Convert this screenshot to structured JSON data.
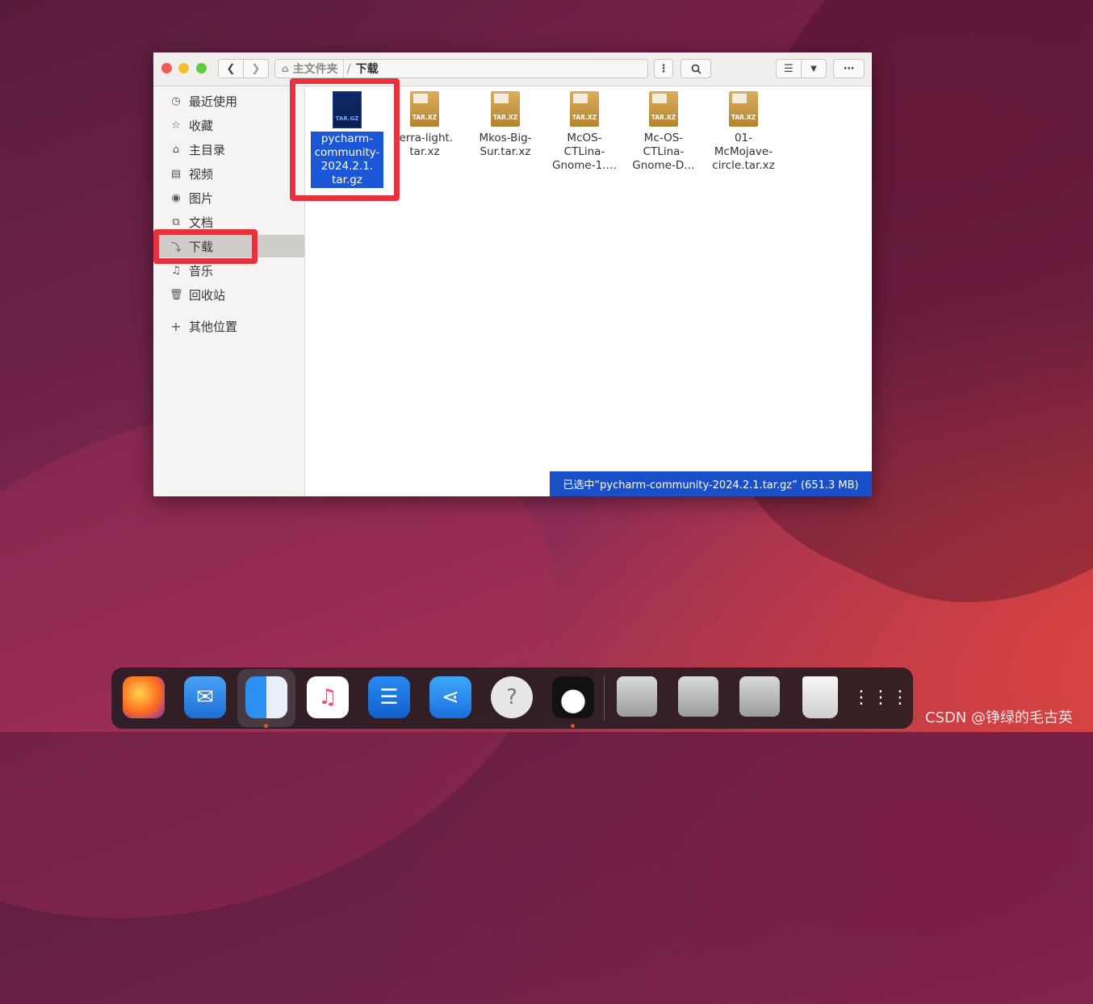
{
  "window": {
    "breadcrumb": {
      "home": "主文件夹",
      "separator": "/",
      "current": "下载"
    }
  },
  "sidebar": {
    "items": [
      {
        "label": "最近使用",
        "icon": "clock-icon"
      },
      {
        "label": "收藏",
        "icon": "star-icon"
      },
      {
        "label": "主目录",
        "icon": "home-icon"
      },
      {
        "label": "视频",
        "icon": "video-icon"
      },
      {
        "label": "图片",
        "icon": "camera-icon"
      },
      {
        "label": "文档",
        "icon": "document-icon"
      },
      {
        "label": "下载",
        "icon": "download-icon",
        "active": true
      },
      {
        "label": "音乐",
        "icon": "music-icon"
      },
      {
        "label": "回收站",
        "icon": "trash-icon"
      },
      {
        "label": "其他位置",
        "icon": "plus-icon"
      }
    ]
  },
  "files": [
    {
      "name_lines": [
        "pycharm-",
        "community-",
        "2024.2.1.",
        "tar.gz"
      ],
      "badge": "TAR.GZ",
      "selected": true
    },
    {
      "name_lines": [
        "ierra-light.",
        "tar.xz"
      ],
      "badge": "TAR.XZ"
    },
    {
      "name_lines": [
        "Mkos-Big-",
        "Sur.tar.xz"
      ],
      "badge": "TAR.XZ"
    },
    {
      "name_lines": [
        "McOS-",
        "CTLina-",
        "Gnome-1.…"
      ],
      "badge": "TAR.XZ"
    },
    {
      "name_lines": [
        "Mc-OS-",
        "CTLina-",
        "Gnome-D…"
      ],
      "badge": "TAR.XZ"
    },
    {
      "name_lines": [
        "01-",
        "McMojave-",
        "circle.tar.xz"
      ],
      "badge": "TAR.XZ"
    }
  ],
  "status": "已选中“pycharm-community-2024.2.1.tar.gz” (651.3 MB)",
  "dock": {
    "apps": [
      "firefox-icon",
      "mail-icon",
      "finder-icon",
      "music-icon",
      "text-editor-icon",
      "app-store-icon",
      "help-icon",
      "qq-icon",
      "drive-icon",
      "drive-icon",
      "drive-icon",
      "trash-icon",
      "app-grid-icon"
    ]
  },
  "watermark": "CSDN @铮绿的毛古英",
  "colors": {
    "accent": "#1b57d6",
    "highlight": "#e5323e"
  }
}
